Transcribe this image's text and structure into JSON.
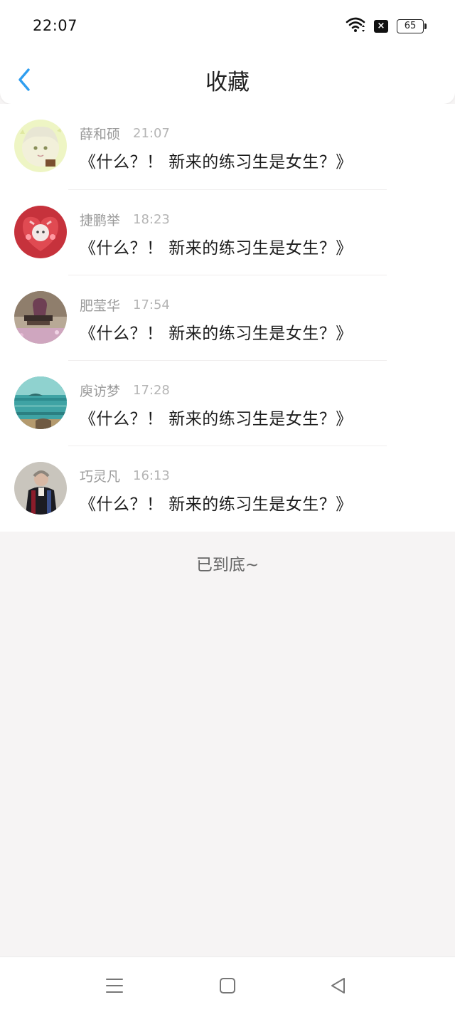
{
  "status_bar": {
    "time": "22:07",
    "battery": "65",
    "icons": [
      "wifi-icon",
      "no-sim-icon",
      "battery-icon"
    ]
  },
  "header": {
    "title": "收藏",
    "back_icon": "chevron-left-icon",
    "accent_color": "#2f9ef0"
  },
  "favorites": [
    {
      "name": "薛和硕",
      "time": "21:07",
      "text": "《什么？！ 新来的练习生是女生？》"
    },
    {
      "name": "捷鹏举",
      "time": "18:23",
      "text": "《什么？！ 新来的练习生是女生？》"
    },
    {
      "name": "肥莹华",
      "time": "17:54",
      "text": "《什么？！ 新来的练习生是女生？》"
    },
    {
      "name": "庾访梦",
      "time": "17:28",
      "text": "《什么？！ 新来的练习生是女生？》"
    },
    {
      "name": "巧灵凡",
      "time": "16:13",
      "text": "《什么？！ 新来的练习生是女生？》"
    }
  ],
  "end_text": "已到底~",
  "nav_bar": {
    "icons": [
      "menu-icon",
      "home-square-icon",
      "back-triangle-icon"
    ]
  }
}
